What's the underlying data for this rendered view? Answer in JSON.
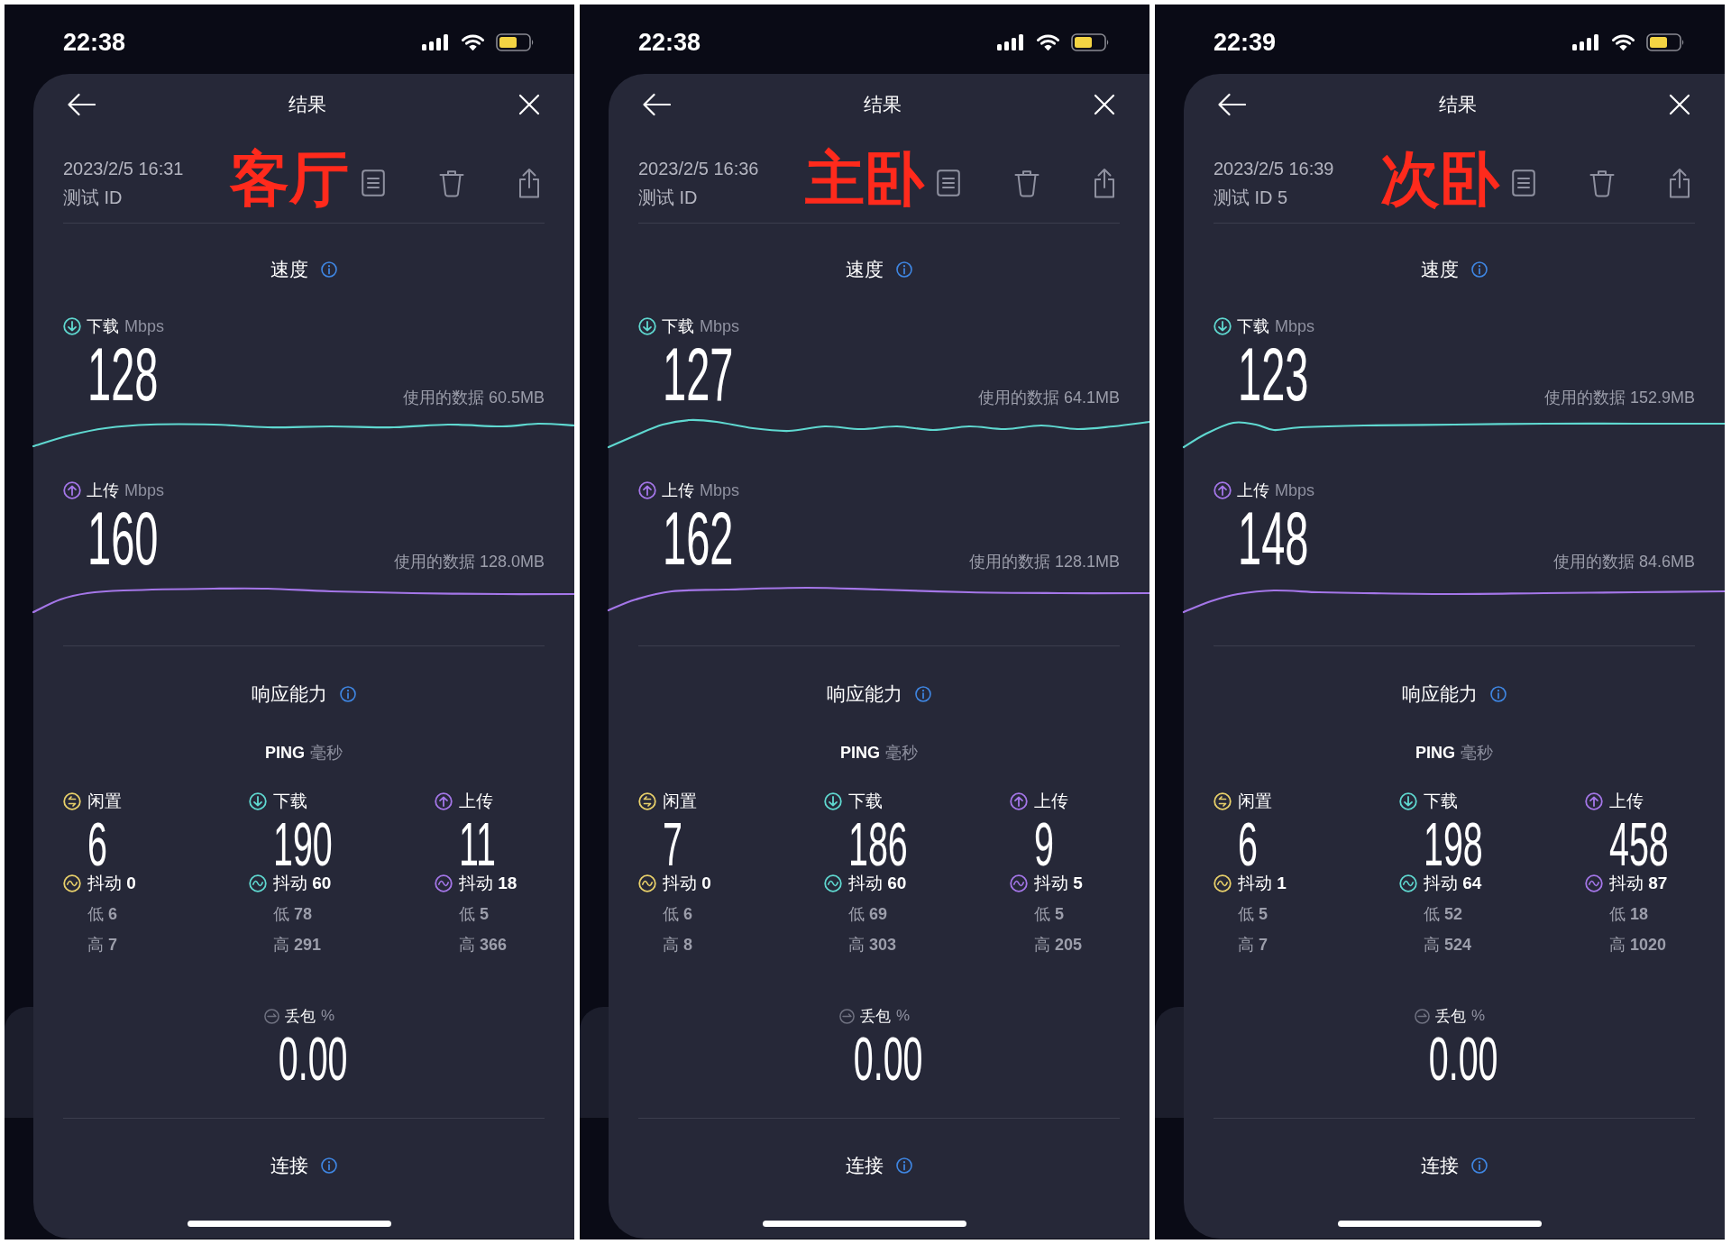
{
  "panels": [
    {
      "status_bar": {
        "time": "22:38"
      },
      "header": {
        "title": "结果"
      },
      "test": {
        "date": "2023/2/5 16:31",
        "test_id": "测试 ID"
      },
      "annotation": "客厅",
      "speed": {
        "title": "速度",
        "items": [
          {
            "kind": "download",
            "label": "下载",
            "unit": "Mbps",
            "value": "128",
            "data_used": "使用的数据 60.5MB"
          },
          {
            "kind": "upload",
            "label": "上传",
            "unit": "Mbps",
            "value": "160",
            "data_used": "使用的数据 128.0MB"
          }
        ]
      },
      "responsiveness": {
        "title": "响应能力",
        "ping_label": "PING",
        "ping_unit": "毫秒",
        "columns": [
          {
            "kind": "idle",
            "label": "闲置",
            "value": "6",
            "jitter": "抖动 **0**",
            "low": "低 **6**",
            "high": "高 **7**"
          },
          {
            "kind": "download",
            "label": "下载",
            "value": "190",
            "jitter": "抖动 **60**",
            "low": "低 **78**",
            "high": "高 **291**"
          },
          {
            "kind": "upload",
            "label": "上传",
            "value": "11",
            "jitter": "抖动 **18**",
            "low": "低 **5**",
            "high": "高 **366**"
          }
        ]
      },
      "packet_loss": {
        "label": "丢包",
        "unit": "%",
        "value": "0.00"
      },
      "connection": {
        "title": "连接"
      }
    },
    {
      "status_bar": {
        "time": "22:38"
      },
      "header": {
        "title": "结果"
      },
      "test": {
        "date": "2023/2/5 16:36",
        "test_id": "测试 ID"
      },
      "annotation": "主卧",
      "speed": {
        "title": "速度",
        "items": [
          {
            "kind": "download",
            "label": "下载",
            "unit": "Mbps",
            "value": "127",
            "data_used": "使用的数据 64.1MB"
          },
          {
            "kind": "upload",
            "label": "上传",
            "unit": "Mbps",
            "value": "162",
            "data_used": "使用的数据 128.1MB"
          }
        ]
      },
      "responsiveness": {
        "title": "响应能力",
        "ping_label": "PING",
        "ping_unit": "毫秒",
        "columns": [
          {
            "kind": "idle",
            "label": "闲置",
            "value": "7",
            "jitter": "抖动 **0**",
            "low": "低 **6**",
            "high": "高 **8**"
          },
          {
            "kind": "download",
            "label": "下载",
            "value": "186",
            "jitter": "抖动 **60**",
            "low": "低 **69**",
            "high": "高 **303**"
          },
          {
            "kind": "upload",
            "label": "上传",
            "value": "9",
            "jitter": "抖动 **5**",
            "low": "低 **5**",
            "high": "高 **205**"
          }
        ]
      },
      "packet_loss": {
        "label": "丢包",
        "unit": "%",
        "value": "0.00"
      },
      "connection": {
        "title": "连接"
      }
    },
    {
      "status_bar": {
        "time": "22:39"
      },
      "header": {
        "title": "结果"
      },
      "test": {
        "date": "2023/2/5 16:39",
        "test_id": "测试 ID 5"
      },
      "annotation": "次卧",
      "speed": {
        "title": "速度",
        "items": [
          {
            "kind": "download",
            "label": "下载",
            "unit": "Mbps",
            "value": "123",
            "data_used": "使用的数据 152.9MB"
          },
          {
            "kind": "upload",
            "label": "上传",
            "unit": "Mbps",
            "value": "148",
            "data_used": "使用的数据 84.6MB"
          }
        ]
      },
      "responsiveness": {
        "title": "响应能力",
        "ping_label": "PING",
        "ping_unit": "毫秒",
        "columns": [
          {
            "kind": "idle",
            "label": "闲置",
            "value": "6",
            "jitter": "抖动 **1**",
            "low": "低 **5**",
            "high": "高 **7**"
          },
          {
            "kind": "download",
            "label": "下载",
            "value": "198",
            "jitter": "抖动 **64**",
            "low": "低 **52**",
            "high": "高 **524**"
          },
          {
            "kind": "upload",
            "label": "上传",
            "value": "458",
            "jitter": "抖动 **87**",
            "low": "低 **18**",
            "high": "高 **1020**"
          }
        ]
      },
      "packet_loss": {
        "label": "丢包",
        "unit": "%",
        "value": "0.00"
      },
      "connection": {
        "title": "连接"
      }
    }
  ]
}
